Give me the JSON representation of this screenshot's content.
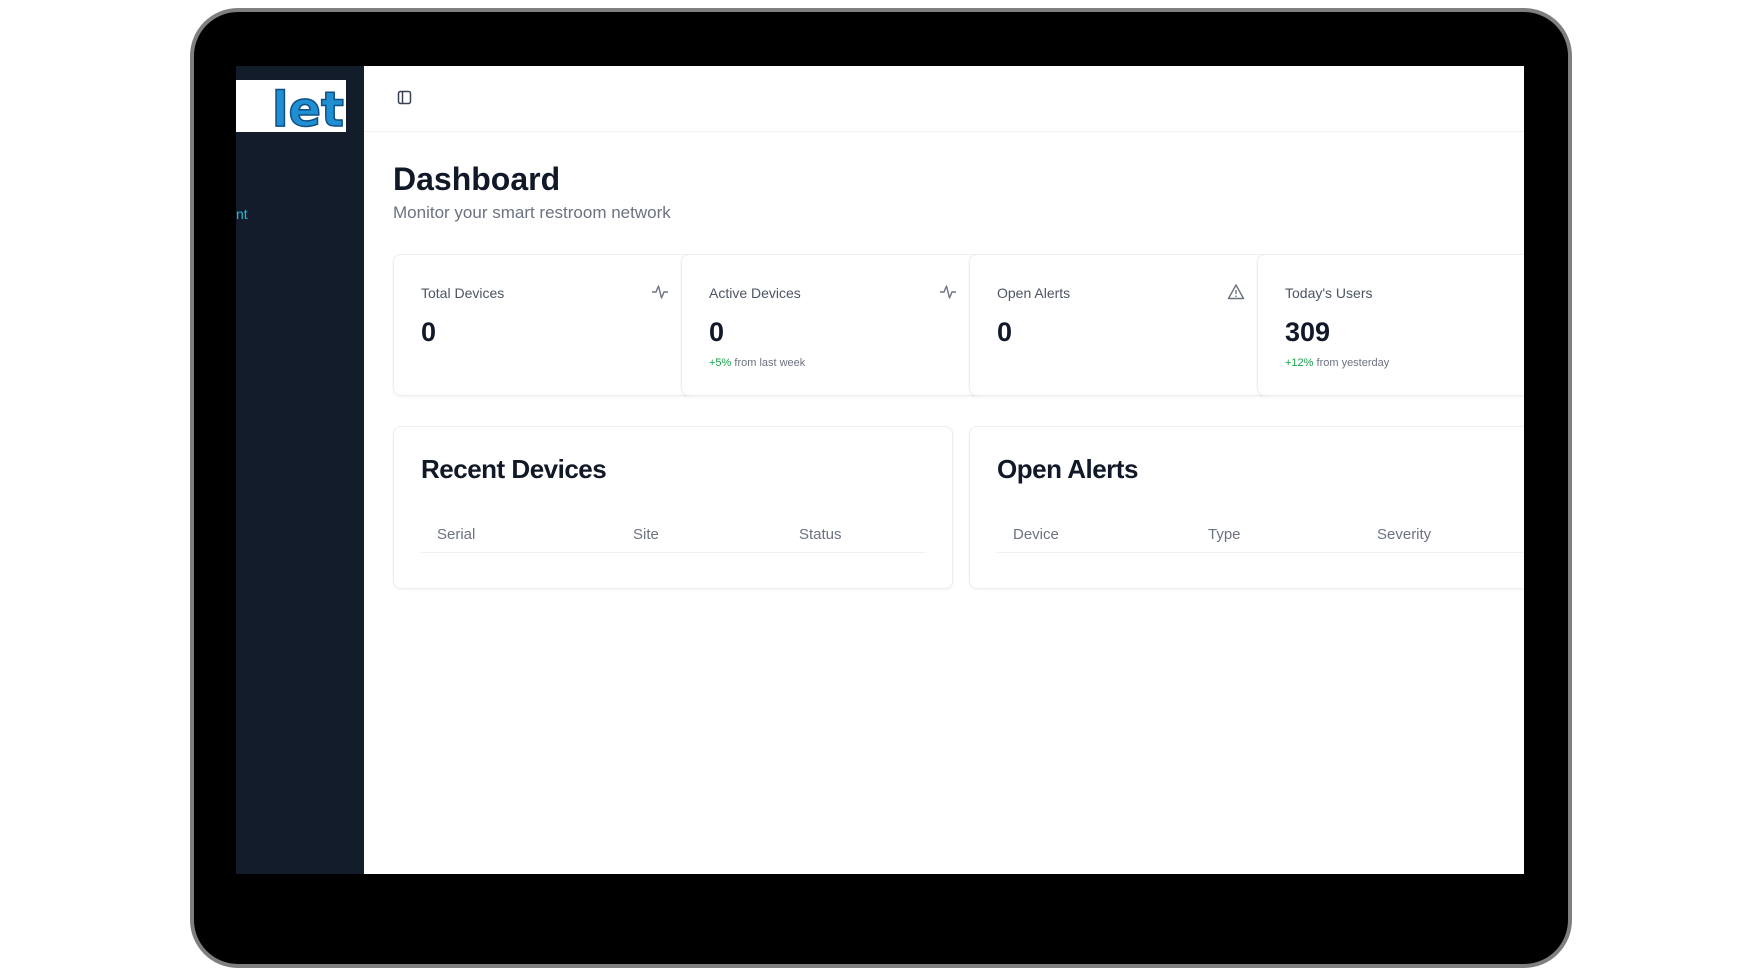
{
  "sidebar": {
    "logo_text": "let",
    "active_item": "nt"
  },
  "header": {
    "toggle_icon": "sidebar-toggle-icon"
  },
  "page": {
    "title": "Dashboard",
    "subtitle": "Monitor your smart restroom network"
  },
  "stats": [
    {
      "label": "Total Devices",
      "value": "0",
      "icon": "activity-icon",
      "change": "",
      "change_suffix": ""
    },
    {
      "label": "Active Devices",
      "value": "0",
      "icon": "activity-icon",
      "change": "+5%",
      "change_suffix": " from last week"
    },
    {
      "label": "Open Alerts",
      "value": "0",
      "icon": "alert-triangle-icon",
      "change": "",
      "change_suffix": ""
    },
    {
      "label": "Today's Users",
      "value": "309",
      "icon": "",
      "change": "+12%",
      "change_suffix": " from yesterday"
    }
  ],
  "recent_devices": {
    "title": "Recent Devices",
    "columns": [
      "Serial",
      "Site",
      "Status"
    ]
  },
  "open_alerts": {
    "title": "Open Alerts",
    "columns": [
      "Device",
      "Type",
      "Severity"
    ]
  },
  "colors": {
    "sidebar_bg": "#131c2a",
    "accent": "#25b8d4",
    "positive": "#16a34a"
  }
}
